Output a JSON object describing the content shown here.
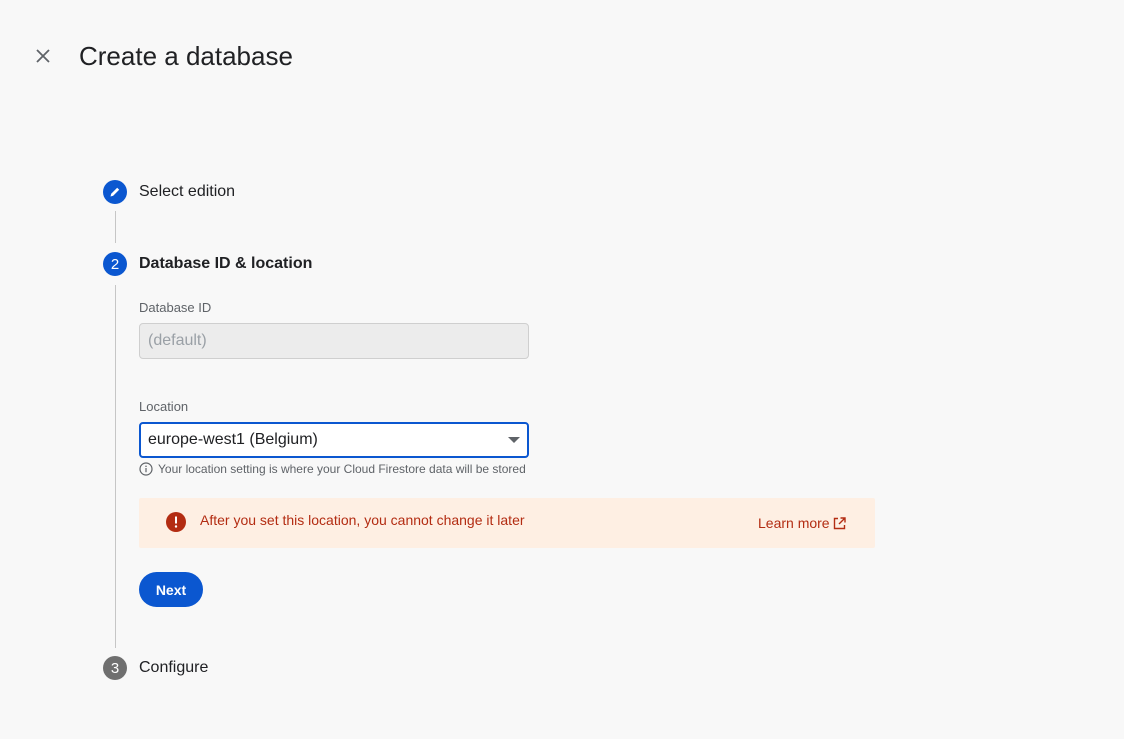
{
  "header": {
    "title": "Create a database"
  },
  "steps": [
    {
      "number": "",
      "label": "Select edition",
      "state": "completed"
    },
    {
      "number": "2",
      "label": "Database ID & location",
      "state": "active"
    },
    {
      "number": "3",
      "label": "Configure",
      "state": "upcoming"
    }
  ],
  "form": {
    "database_id_label": "Database ID",
    "database_id_placeholder": "(default)",
    "location_label": "Location",
    "location_value": "europe-west1 (Belgium)",
    "location_hint": "Your location setting is where your Cloud Firestore data will be stored"
  },
  "warning": {
    "text": "After you set this location, you cannot change it later",
    "link_label": "Learn more"
  },
  "actions": {
    "next_label": "Next"
  },
  "colors": {
    "accent": "#0b57d0",
    "warning_bg": "#feefe3",
    "warning_text": "#b32c12",
    "upcoming_step": "#6f6f6f"
  }
}
